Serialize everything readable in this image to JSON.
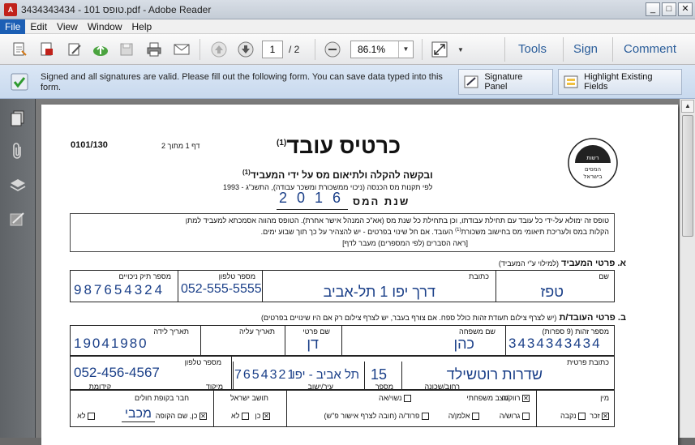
{
  "window": {
    "title": "3434343434 - 101 טופס.pdf - Adobe Reader",
    "app_icon": "pdf-icon",
    "controls": [
      "minimize",
      "maximize",
      "close"
    ]
  },
  "menu": [
    "File",
    "Edit",
    "View",
    "Window",
    "Help"
  ],
  "toolbar": {
    "page_current": "1",
    "page_total": "/ 2",
    "zoom": "86.1%",
    "tools_label": "Tools",
    "sign_label": "Sign",
    "comment_label": "Comment"
  },
  "message_bar": {
    "text": "Signed and all signatures are valid.  Please fill out the following form. You can save data typed into this form.",
    "signature_panel_label": "Signature Panel",
    "highlight_fields_label": "Highlight Existing Fields"
  },
  "form": {
    "form_number": "0101/130",
    "page_indicator": "דף 1 מתוך 2",
    "title": "כרטיס עובד",
    "title_footnote": "(1)",
    "subtitle": "ובקשה להקלה ולתיאום מס על ידי המעביד",
    "subtitle_footnote": "(1)",
    "regulation": "לפי תקנות מס הכנסה (ניכוי ממשכורת ומשכר עבודה), התשנ\"ג - 1993",
    "tax_year_label": "שנת המס",
    "tax_year": [
      "2",
      "0",
      "1",
      "6"
    ],
    "logo_text": "רשות המסים בישראל",
    "instructions_line1": "טופס זה ימולא על-ידי כל עובד עם תחילת עבודתו, וכן בתחילת כל שנת מס (אא\"כ המנהל אישר אחרת). הטופס מהווה אסמכתא למעביד למתן",
    "instructions_line2": "הקלות במס ולעריכת תיאומי מס בחישוב משכורת",
    "instructions_line2b": "העובד. אם חל שינוי בפרטים - יש להצהיר על כך תוך שבוע ימים.",
    "instructions_line3": "[ראה הסברים (לפי המספרים) מעבר לדף]",
    "section_a": {
      "title": "א.  פרטי המעביד",
      "note": "(למילוי ע\"י המעביד)",
      "name_label": "שם",
      "name_value": "טפז",
      "address_label": "כתובת",
      "address_value": "דרך יפו 1 תל-אביב",
      "phone_label": "מספר טלפון",
      "phone_value": "052-555-5555",
      "tax_file_label": "מספר תיק ניכויים",
      "tax_file_value": "987654324"
    },
    "section_b": {
      "title": "ב.  פרטי העובד/ת",
      "note": "(יש לצרף צילום תעודת זהות כולל  ספח. אם צורף בעבר, יש לצרף צילום רק אם היו שינויים בפרטים)",
      "id_label": "מספר זהות (9 ספרות)",
      "id_value": "3434343434",
      "last_name_label": "שם משפחה",
      "last_name_value": "כהן",
      "first_name_label": "שם פרטי",
      "first_name_value": "דן",
      "aliya_label": "תאריך עליה",
      "aliya_value": "",
      "birth_label": "תאריך לידה",
      "birth_value": "19041980",
      "address_label": "כתובת פרטית",
      "street_label": "רחוב/שכונה",
      "street_value": "שדרות רוטשילד",
      "number_label": "מספר",
      "number_value": "15",
      "city_label": "עיר/ישוב",
      "city_value": "תל אביב - יפו",
      "zip_label": "מיקוד",
      "zip_value": "7654321",
      "phone_label": "מספר טלפון",
      "phone_value": "052-456-4567",
      "kidomet_label": "קידומת",
      "gender_label": "מין",
      "gender_male": "זכר",
      "gender_female": "נקבה",
      "marital_label": "מצב משפחתי",
      "marital_options": [
        "רווק/ה",
        "נשוי/אה",
        "גרוש/ה",
        "אלמן/ה",
        "פרוד/ה (חובה לצרף אישור פ\"ש)"
      ],
      "resident_label": "תושב ישראל",
      "resident_yes": "כן",
      "resident_no": "לא",
      "kupa_label": "חבר בקופת חולים",
      "kupa_yes": "כן, שם הקופה",
      "kupa_value": "מכבי",
      "kupa_no": "לא"
    }
  }
}
